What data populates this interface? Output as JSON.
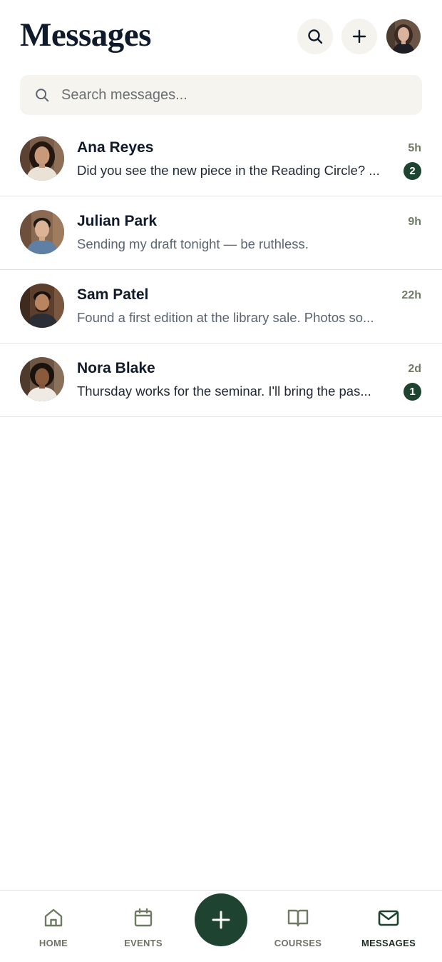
{
  "header": {
    "title": "Messages",
    "search_button_icon": "search-icon",
    "add_button_icon": "plus-icon",
    "profile_avatar": "user-avatar"
  },
  "search": {
    "placeholder": "Search messages..."
  },
  "conversations": [
    {
      "name": "Ana Reyes",
      "time": "5h",
      "preview": "Did you see the new piece in the Reading Circle? ...",
      "unread_count": "2"
    },
    {
      "name": "Julian Park",
      "time": "9h",
      "preview": "Sending my draft tonight — be ruthless.",
      "unread_count": ""
    },
    {
      "name": "Sam Patel",
      "time": "22h",
      "preview": "Found a first edition at the library sale. Photos so...",
      "unread_count": ""
    },
    {
      "name": "Nora Blake",
      "time": "2d",
      "preview": "Thursday works for the seminar. I'll bring the pas...",
      "unread_count": "1"
    }
  ],
  "tabbar": {
    "home": "HOME",
    "events": "EVENTS",
    "courses": "COURSES",
    "messages": "MESSAGES",
    "active": "messages",
    "fab_icon": "plus-icon"
  },
  "colors": {
    "accent": "#1f4331",
    "background": "#ffffff",
    "search_bg": "#f6f4ef",
    "time_text": "#6f7a63"
  }
}
